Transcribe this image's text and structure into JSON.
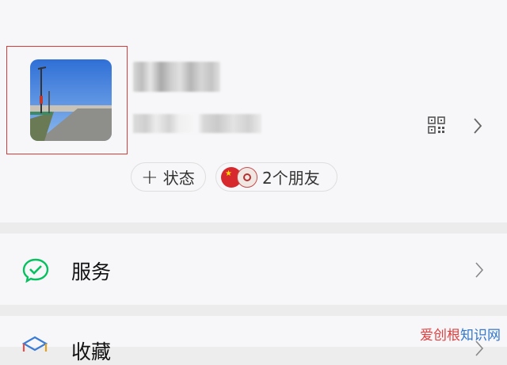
{
  "profile": {
    "avatar_icon": "road-photo",
    "qr_icon": "qr-code-icon",
    "chevron_icon": "chevron-right-icon"
  },
  "status_pill": {
    "plus": "+",
    "label": "状态"
  },
  "friends_pill": {
    "label": "2个朋友"
  },
  "menu": {
    "service": {
      "icon": "wechat-pay-icon",
      "label": "服务",
      "accent": "#07c160"
    },
    "favorites": {
      "icon": "favorites-cube-icon",
      "label": "收藏"
    }
  },
  "watermark": {
    "part1": "爱",
    "part2": "创根",
    "part3": "知识网"
  }
}
